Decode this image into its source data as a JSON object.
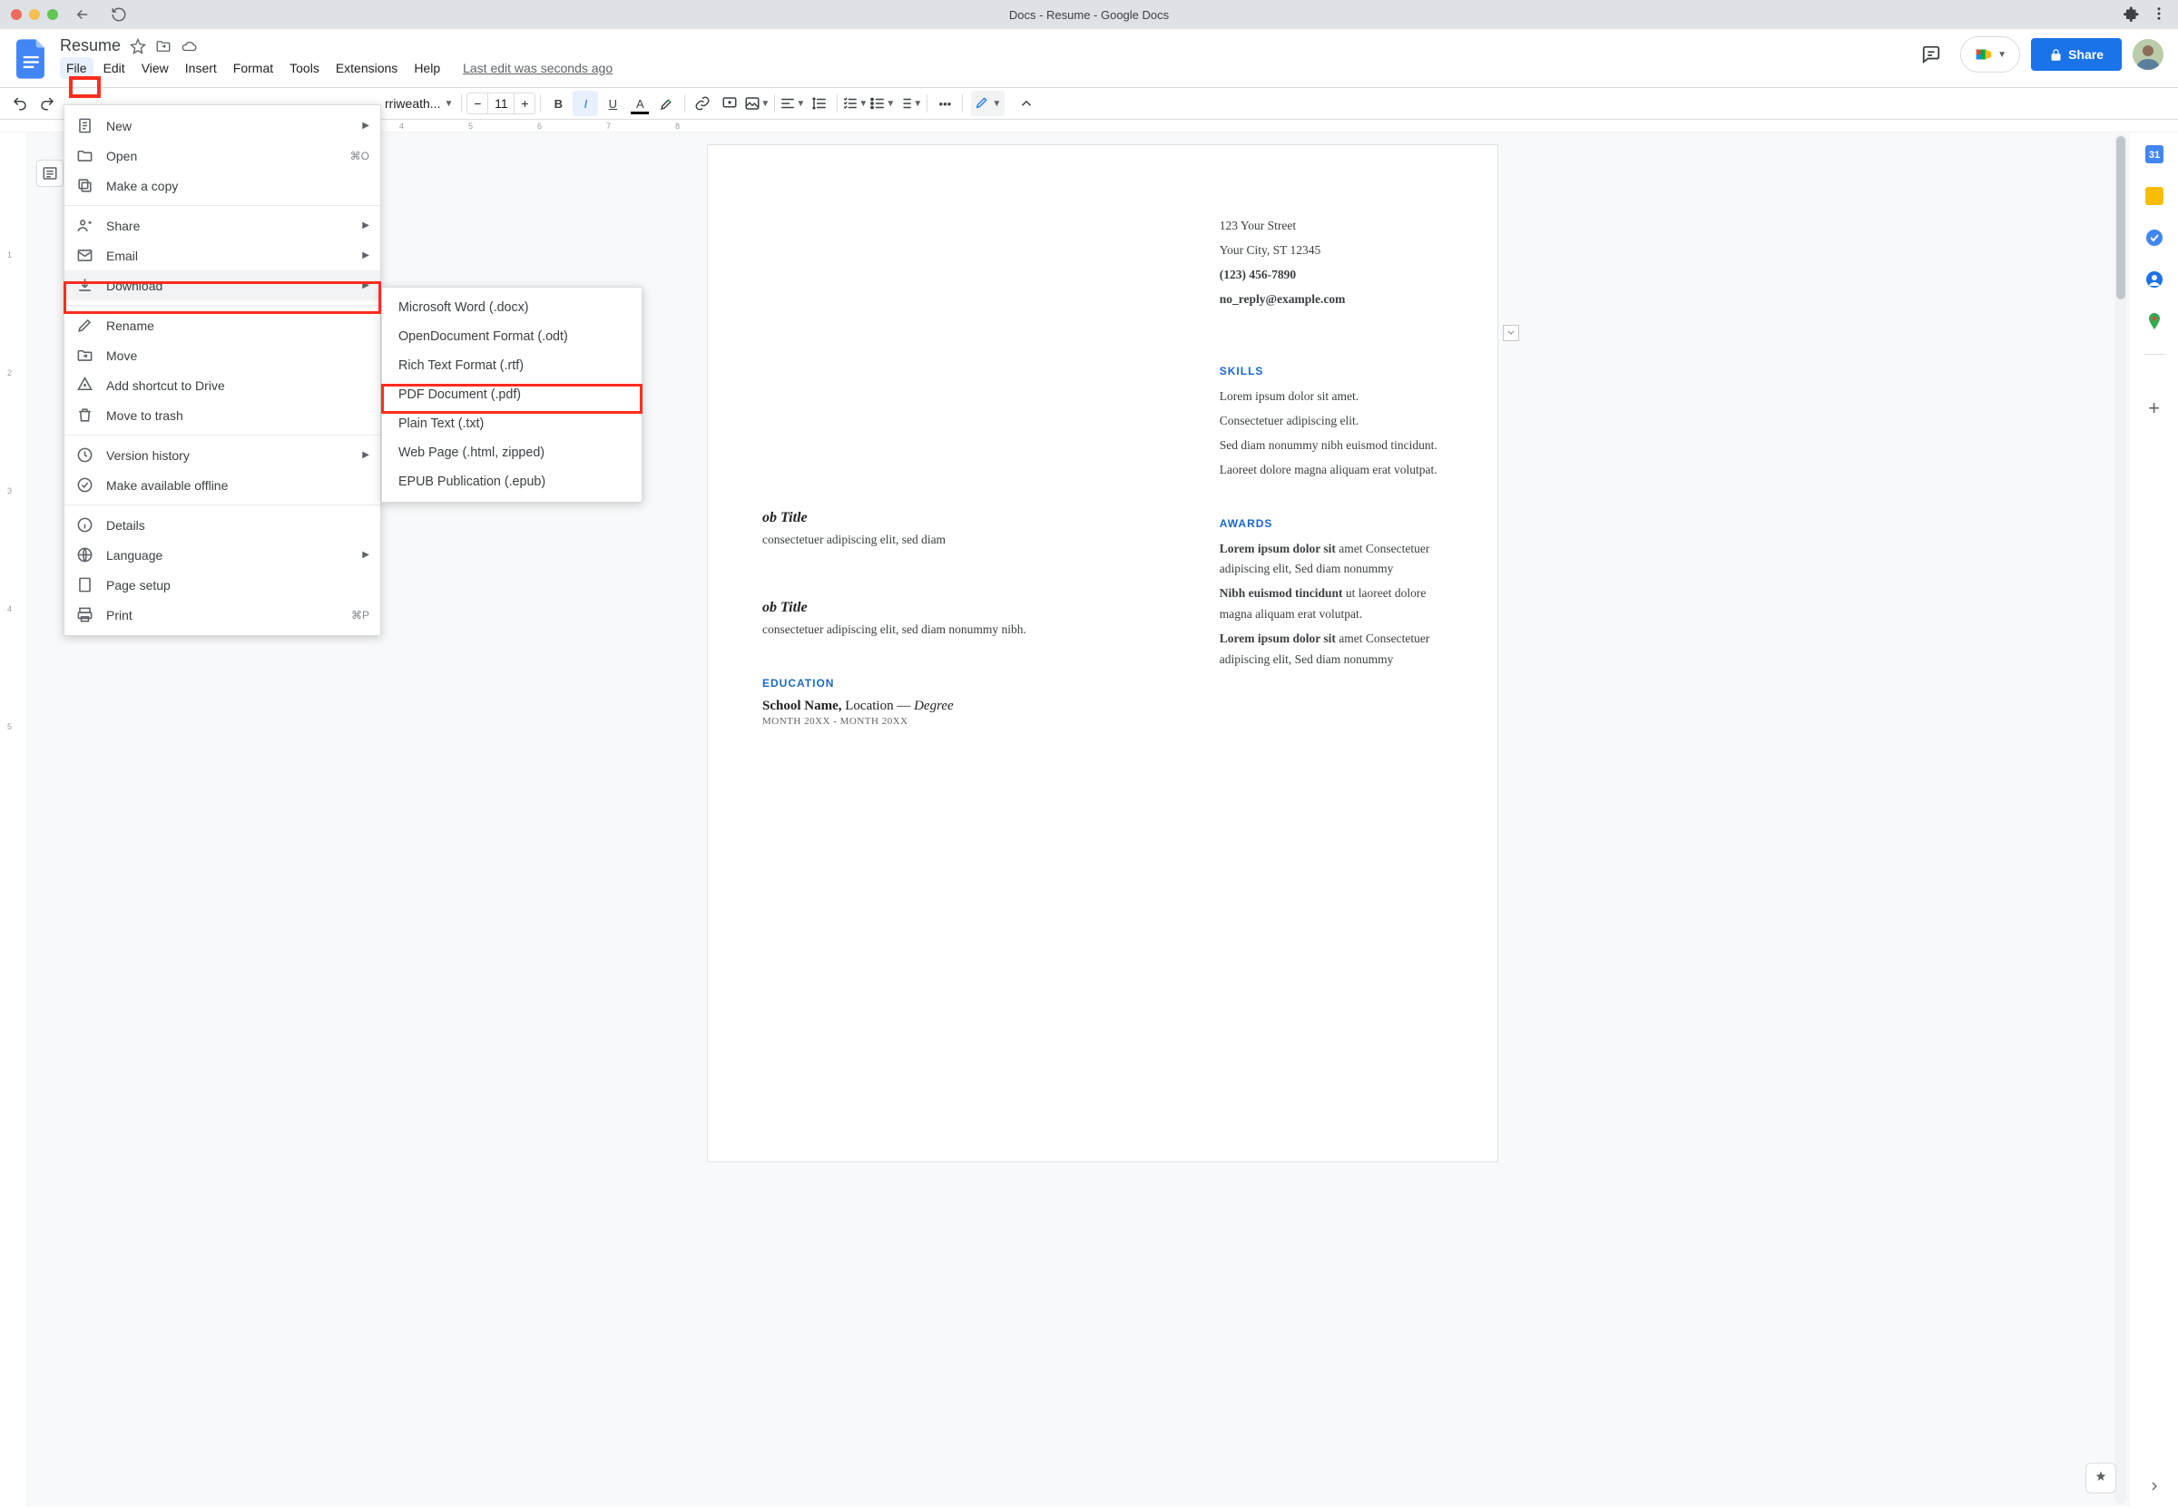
{
  "chrome": {
    "title": "Docs - Resume - Google Docs"
  },
  "doc": {
    "title": "Resume"
  },
  "menubar": {
    "file": "File",
    "edit": "Edit",
    "view": "View",
    "insert": "Insert",
    "format": "Format",
    "tools": "Tools",
    "extensions": "Extensions",
    "help": "Help",
    "lastedit": "Last edit was seconds ago"
  },
  "header": {
    "share": "Share"
  },
  "toolbar": {
    "font": "rriweath...",
    "size": "11"
  },
  "ruler": {
    "marks": [
      "4",
      "5",
      "6",
      "7",
      "8"
    ]
  },
  "filemenu": {
    "new": "New",
    "open": "Open",
    "open_kb": "⌘O",
    "copy": "Make a copy",
    "share": "Share",
    "email": "Email",
    "download": "Download",
    "rename": "Rename",
    "move": "Move",
    "shortcut": "Add shortcut to Drive",
    "trash": "Move to trash",
    "version": "Version history",
    "offline": "Make available offline",
    "details": "Details",
    "language": "Language",
    "pagesetup": "Page setup",
    "print": "Print",
    "print_kb": "⌘P"
  },
  "download_menu": {
    "docx": "Microsoft Word (.docx)",
    "odt": "OpenDocument Format (.odt)",
    "rtf": "Rich Text Format (.rtf)",
    "pdf": "PDF Document (.pdf)",
    "txt": "Plain Text (.txt)",
    "html": "Web Page (.html, zipped)",
    "epub": "EPUB Publication (.epub)"
  },
  "resume": {
    "addr1": "123 Your Street",
    "addr2": "Your City, ST 12345",
    "phone": "(123) 456-7890",
    "email": "no_reply@example.com",
    "jt": "ob Title",
    "lorem_partial": "consectetuer adipiscing elit, sed diam",
    "lorem_partial2": "consectetuer adipiscing elit, sed diam nonummy nibh.",
    "edu_head": "EDUCATION",
    "school": "School Name,",
    "school_l": " Location — ",
    "degree": "Degree",
    "sch_meta": "MONTH 20XX - MONTH 20XX",
    "skills_head": "SKILLS",
    "sk1": "Lorem ipsum dolor sit amet.",
    "sk2": "Consectetuer adipiscing elit.",
    "sk3": "Sed diam nonummy nibh euismod tincidunt.",
    "sk4": "Laoreet dolore magna aliquam erat volutpat.",
    "awards_head": "AWARDS",
    "aw1b": "Lorem ipsum dolor sit",
    "aw1": " amet Consectetuer adipiscing elit, Sed diam nonummy",
    "aw2b": "Nibh euismod tincidunt",
    "aw2": " ut laoreet dolore magna aliquam erat volutpat.",
    "aw3b": "Lorem ipsum dolor sit",
    "aw3": " amet Consectetuer adipiscing elit, Sed diam nonummy"
  }
}
